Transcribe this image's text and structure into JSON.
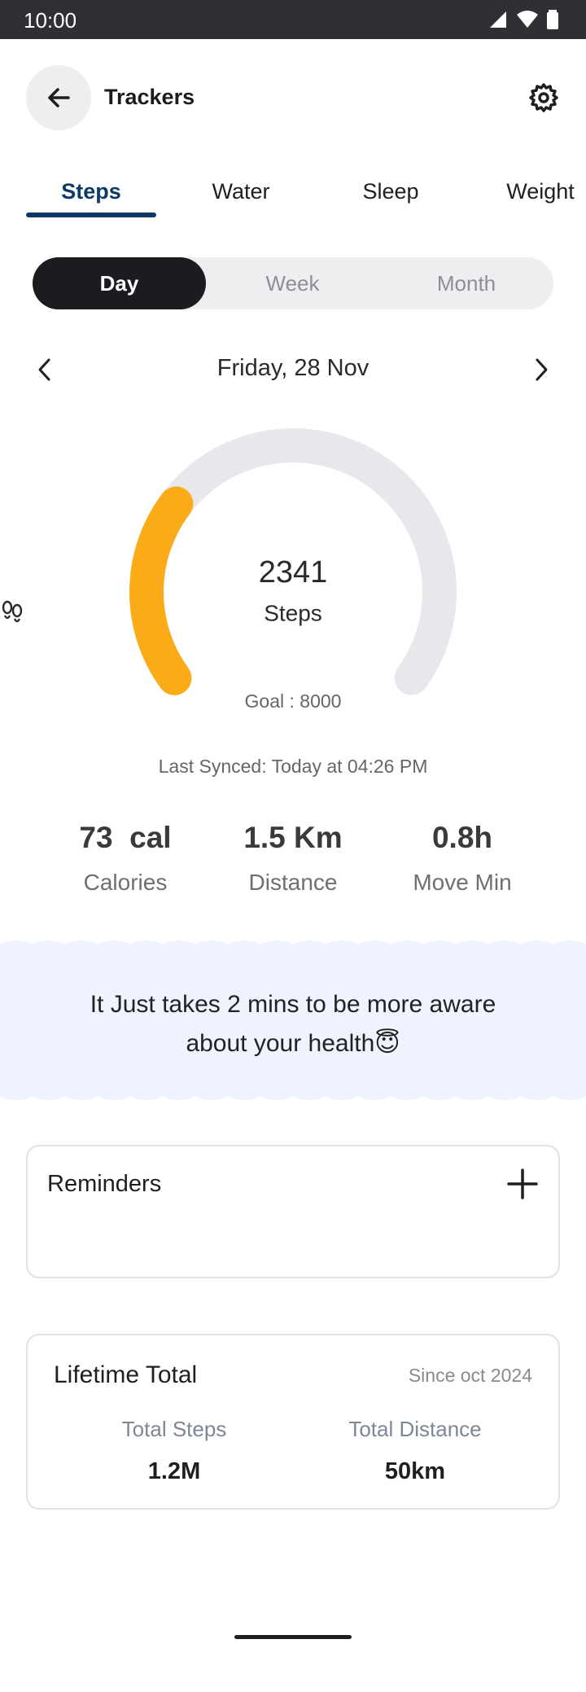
{
  "status_bar": {
    "time": "10:00"
  },
  "header": {
    "title": "Trackers"
  },
  "tabs": [
    {
      "label": "Steps",
      "active": true
    },
    {
      "label": "Water",
      "active": false
    },
    {
      "label": "Sleep",
      "active": false
    },
    {
      "label": "Weight",
      "active": false
    }
  ],
  "period": {
    "options": [
      "Day",
      "Week",
      "Month"
    ],
    "selected": "Day"
  },
  "date": {
    "label": "Friday, 28 Nov"
  },
  "gauge": {
    "steps": "2341",
    "steps_label": "Steps",
    "goal_label": "Goal : 8000",
    "progress_fraction": 0.29
  },
  "last_synced": "Last Synced: Today at 04:26 PM",
  "stats": [
    {
      "value": "73  cal",
      "label": "Calories"
    },
    {
      "value": "1.5 Km",
      "label": "Distance"
    },
    {
      "value": "0.8h",
      "label": "Move Min"
    }
  ],
  "banner": {
    "line1": "It Just takes 2 mins to be more aware",
    "line2": "about your health😇"
  },
  "reminders": {
    "title": "Reminders"
  },
  "lifetime": {
    "title": "Lifetime Total",
    "since": "Since oct 2024",
    "total_steps_label": "Total Steps",
    "total_steps_value": "1.2M",
    "total_distance_label": "Total Distance",
    "total_distance_value": "50km"
  },
  "colors": {
    "accent": "#0e3a66",
    "progress": "#fbab18",
    "track": "#e8e8ec",
    "banner_bg": "#eef3fd"
  }
}
